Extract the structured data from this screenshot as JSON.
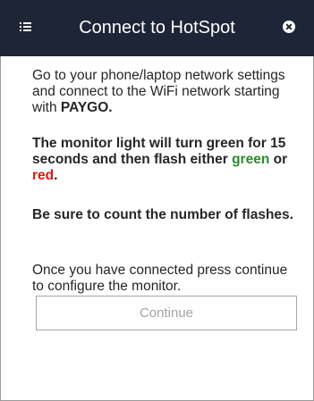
{
  "header": {
    "title": "Connect to HotSpot",
    "background_color": "#1e2536",
    "menu_icon": "menu-icon",
    "close_icon": "close-circle-icon"
  },
  "instructions": {
    "p1_text": "Go to your phone/laptop network settings and connect to the WiFi network starting with ",
    "p1_network": "PAYGO.",
    "p2_text": "The monitor light will turn green for 15 seconds and then flash either ",
    "p2_green": "green",
    "p2_or": " or ",
    "p2_red": "red",
    "p2_end": ".",
    "p3_text": "Be sure to count the number of flashes.",
    "p4_text": "Once you have connected press continue to configure the monitor."
  },
  "colors": {
    "green": "#2c8a2c",
    "red": "#e01515"
  },
  "actions": {
    "continue_label": "Continue"
  }
}
